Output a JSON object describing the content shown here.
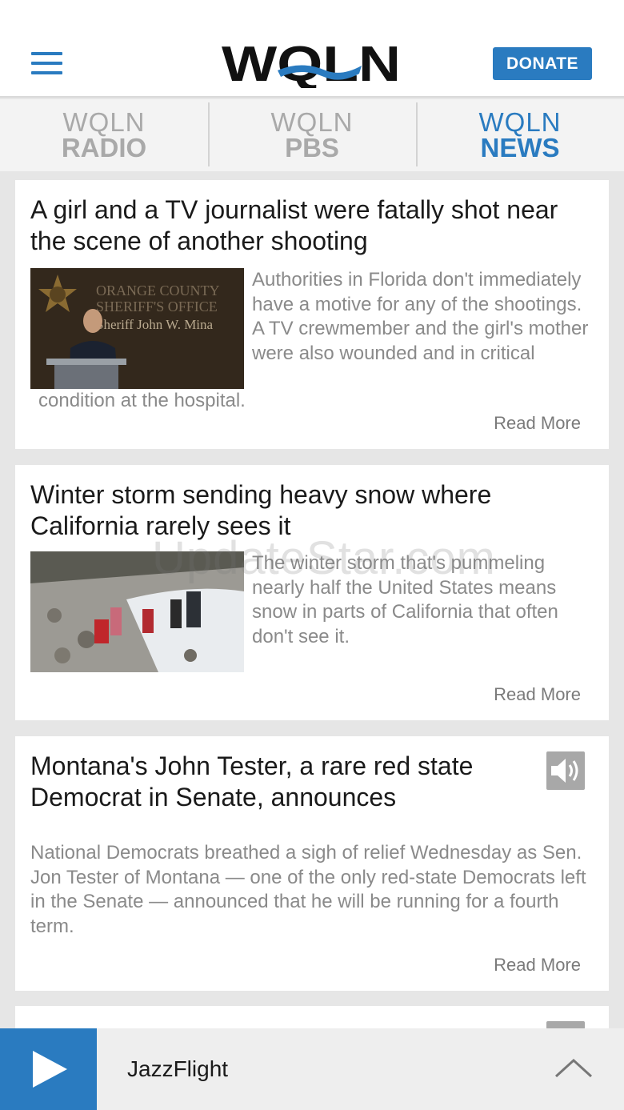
{
  "header": {
    "logo_text": "WQLN",
    "donate_label": "DONATE"
  },
  "tabs": [
    {
      "line1": "WQLN",
      "line2": "RADIO",
      "active": false
    },
    {
      "line1": "WQLN",
      "line2": "PBS",
      "active": false
    },
    {
      "line1": "WQLN",
      "line2": "NEWS",
      "active": true
    }
  ],
  "articles": [
    {
      "title": "A girl and a TV journalist were fatally shot near the scene of another shooting",
      "summary_main": "Authorities in Florida don't immediately have a motive for any of the shootings. A TV crewmember and the girl's mother were also wounded and in critical",
      "summary_tail": "condition at the hospital.",
      "image_caption_lines": [
        "ORANGE COUNTY",
        "SHERIFF'S OFFICE",
        "Sheriff John W. Mina"
      ],
      "read_more": "Read More"
    },
    {
      "title": "Winter storm sending heavy snow where California rarely sees it",
      "summary_main": "The winter storm that's pummeling nearly half the United States means snow in parts of California that often don't see it.",
      "read_more": "Read More"
    },
    {
      "title": "Montana's John Tester, a rare red state Democrat in Senate, announces",
      "summary_main": "National Democrats breathed a sigh of relief Wednesday as Sen. Jon Tester of Montana — one of the only red-state Democrats left in the Senate — announced that he will be running for a fourth term.",
      "read_more": "Read More",
      "icon": "speaker-icon"
    }
  ],
  "player": {
    "station": "JazzFlight"
  },
  "watermark": "UpdateStar.com",
  "colors": {
    "brand_blue": "#2a7bc0",
    "summary_gray": "#8a8a8a"
  }
}
